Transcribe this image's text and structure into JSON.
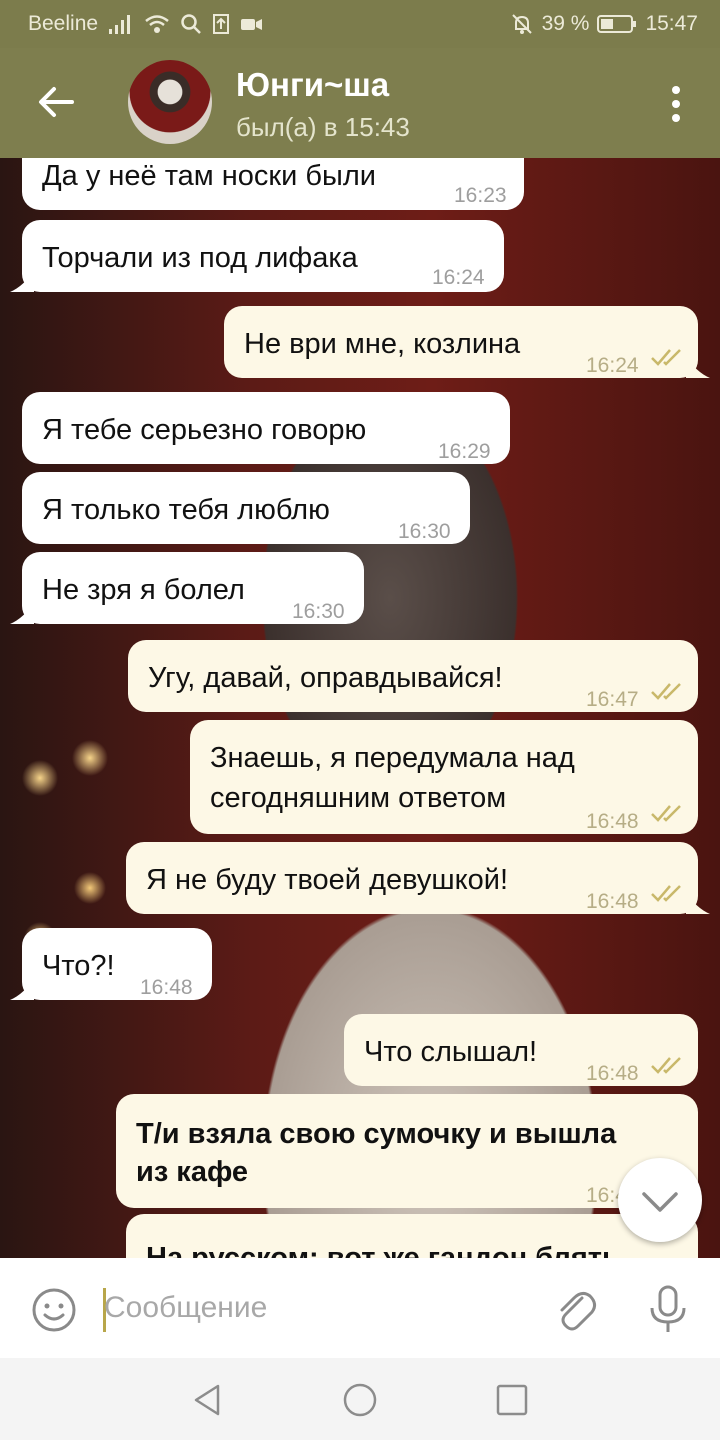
{
  "status_bar": {
    "carrier": "Beeline",
    "battery": "39 %",
    "time": "15:47",
    "icons": [
      "signal-icon",
      "wifi-icon",
      "search-icon",
      "upload-icon",
      "video-icon",
      "mute-icon",
      "battery-icon"
    ]
  },
  "header": {
    "name": "Юнги~ша",
    "status": "был(а) в 15:43"
  },
  "messages": [
    {
      "dir": "in",
      "text": "Да у неё там носки были",
      "time": "16:23"
    },
    {
      "dir": "in",
      "text": "Торчали из под лифака",
      "time": "16:24"
    },
    {
      "dir": "out",
      "text": "Не ври мне, козлина",
      "time": "16:24"
    },
    {
      "dir": "in",
      "text": "Я тебе серьезно говорю",
      "time": "16:29"
    },
    {
      "dir": "in",
      "text": "Я только тебя люблю",
      "time": "16:30"
    },
    {
      "dir": "in",
      "text": "Не зря я болел",
      "time": "16:30"
    },
    {
      "dir": "out",
      "text": "Угу, давай, оправдывайся!",
      "time": "16:47"
    },
    {
      "dir": "out",
      "text_line1": "Знаешь, я передумала над",
      "text_line2": "сегодняшним ответом",
      "time": "16:48"
    },
    {
      "dir": "out",
      "text": "Я не буду твоей девушкой!",
      "time": "16:48"
    },
    {
      "dir": "in",
      "text": "Что?!",
      "time": "16:48"
    },
    {
      "dir": "out",
      "text": "Что слышал!",
      "time": "16:48"
    },
    {
      "dir": "out",
      "text_line1": "Т/и взяла свою сумочку и вышла",
      "text_line2": "из кафе",
      "time": "16:4"
    },
    {
      "dir": "out",
      "text": "На русском: вот же гандон блять"
    }
  ],
  "input": {
    "placeholder": "Сообщение"
  },
  "colors": {
    "header_bg": "#7e7e4e",
    "incoming_bubble": "#ffffff",
    "outgoing_bubble": "#fdf8e6",
    "read_check": "#c9b86a"
  }
}
